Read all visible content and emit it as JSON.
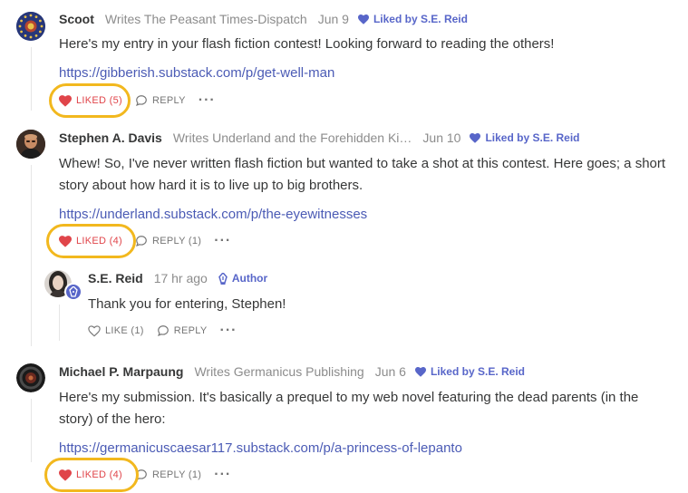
{
  "comments": [
    {
      "author": "Scoot",
      "publication": "Writes The Peasant Times-Dispatch",
      "date": "Jun 9",
      "liked_by": "Liked by S.E. Reid",
      "body": "Here's my entry in your flash fiction contest! Looking forward to reading the others!",
      "link": "https://gibberish.substack.com/p/get-well-man",
      "like_label": "LIKED (5)",
      "reply_label": "REPLY"
    },
    {
      "author": "Stephen A. Davis",
      "publication": "Writes Underland and the Forehidden Ki…",
      "date": "Jun 10",
      "liked_by": "Liked by S.E. Reid",
      "body_line1": "Whew! So, I've never written flash fiction but wanted to take a shot at this contest. Here goes; a short",
      "body_line2": "story about how hard it is to live up to big brothers.",
      "link": "https://underland.substack.com/p/the-eyewitnesses",
      "like_label": "LIKED (4)",
      "reply_label": "REPLY (1)"
    },
    {
      "author": "S.E. Reid",
      "date": "17 hr ago",
      "badge": "Author",
      "body": "Thank you for entering, Stephen!",
      "like_label": "LIKE (1)",
      "reply_label": "REPLY"
    },
    {
      "author": "Michael P. Marpaung",
      "publication": "Writes Germanicus Publishing",
      "date": "Jun 6",
      "liked_by": "Liked by S.E. Reid",
      "body_line1": "Here's my submission. It's basically a prequel to my web novel featuring the dead parents (in the",
      "body_line2": "story) of the hero:",
      "link": "https://germanicuscaesar117.substack.com/p/a-princess-of-lepanto",
      "like_label": "LIKED (4)",
      "reply_label": "REPLY (1)"
    }
  ],
  "colors": {
    "liked": "#e0454a",
    "accent": "#5866c9",
    "link": "#4b5bb5",
    "highlight": "#f2b81e"
  }
}
